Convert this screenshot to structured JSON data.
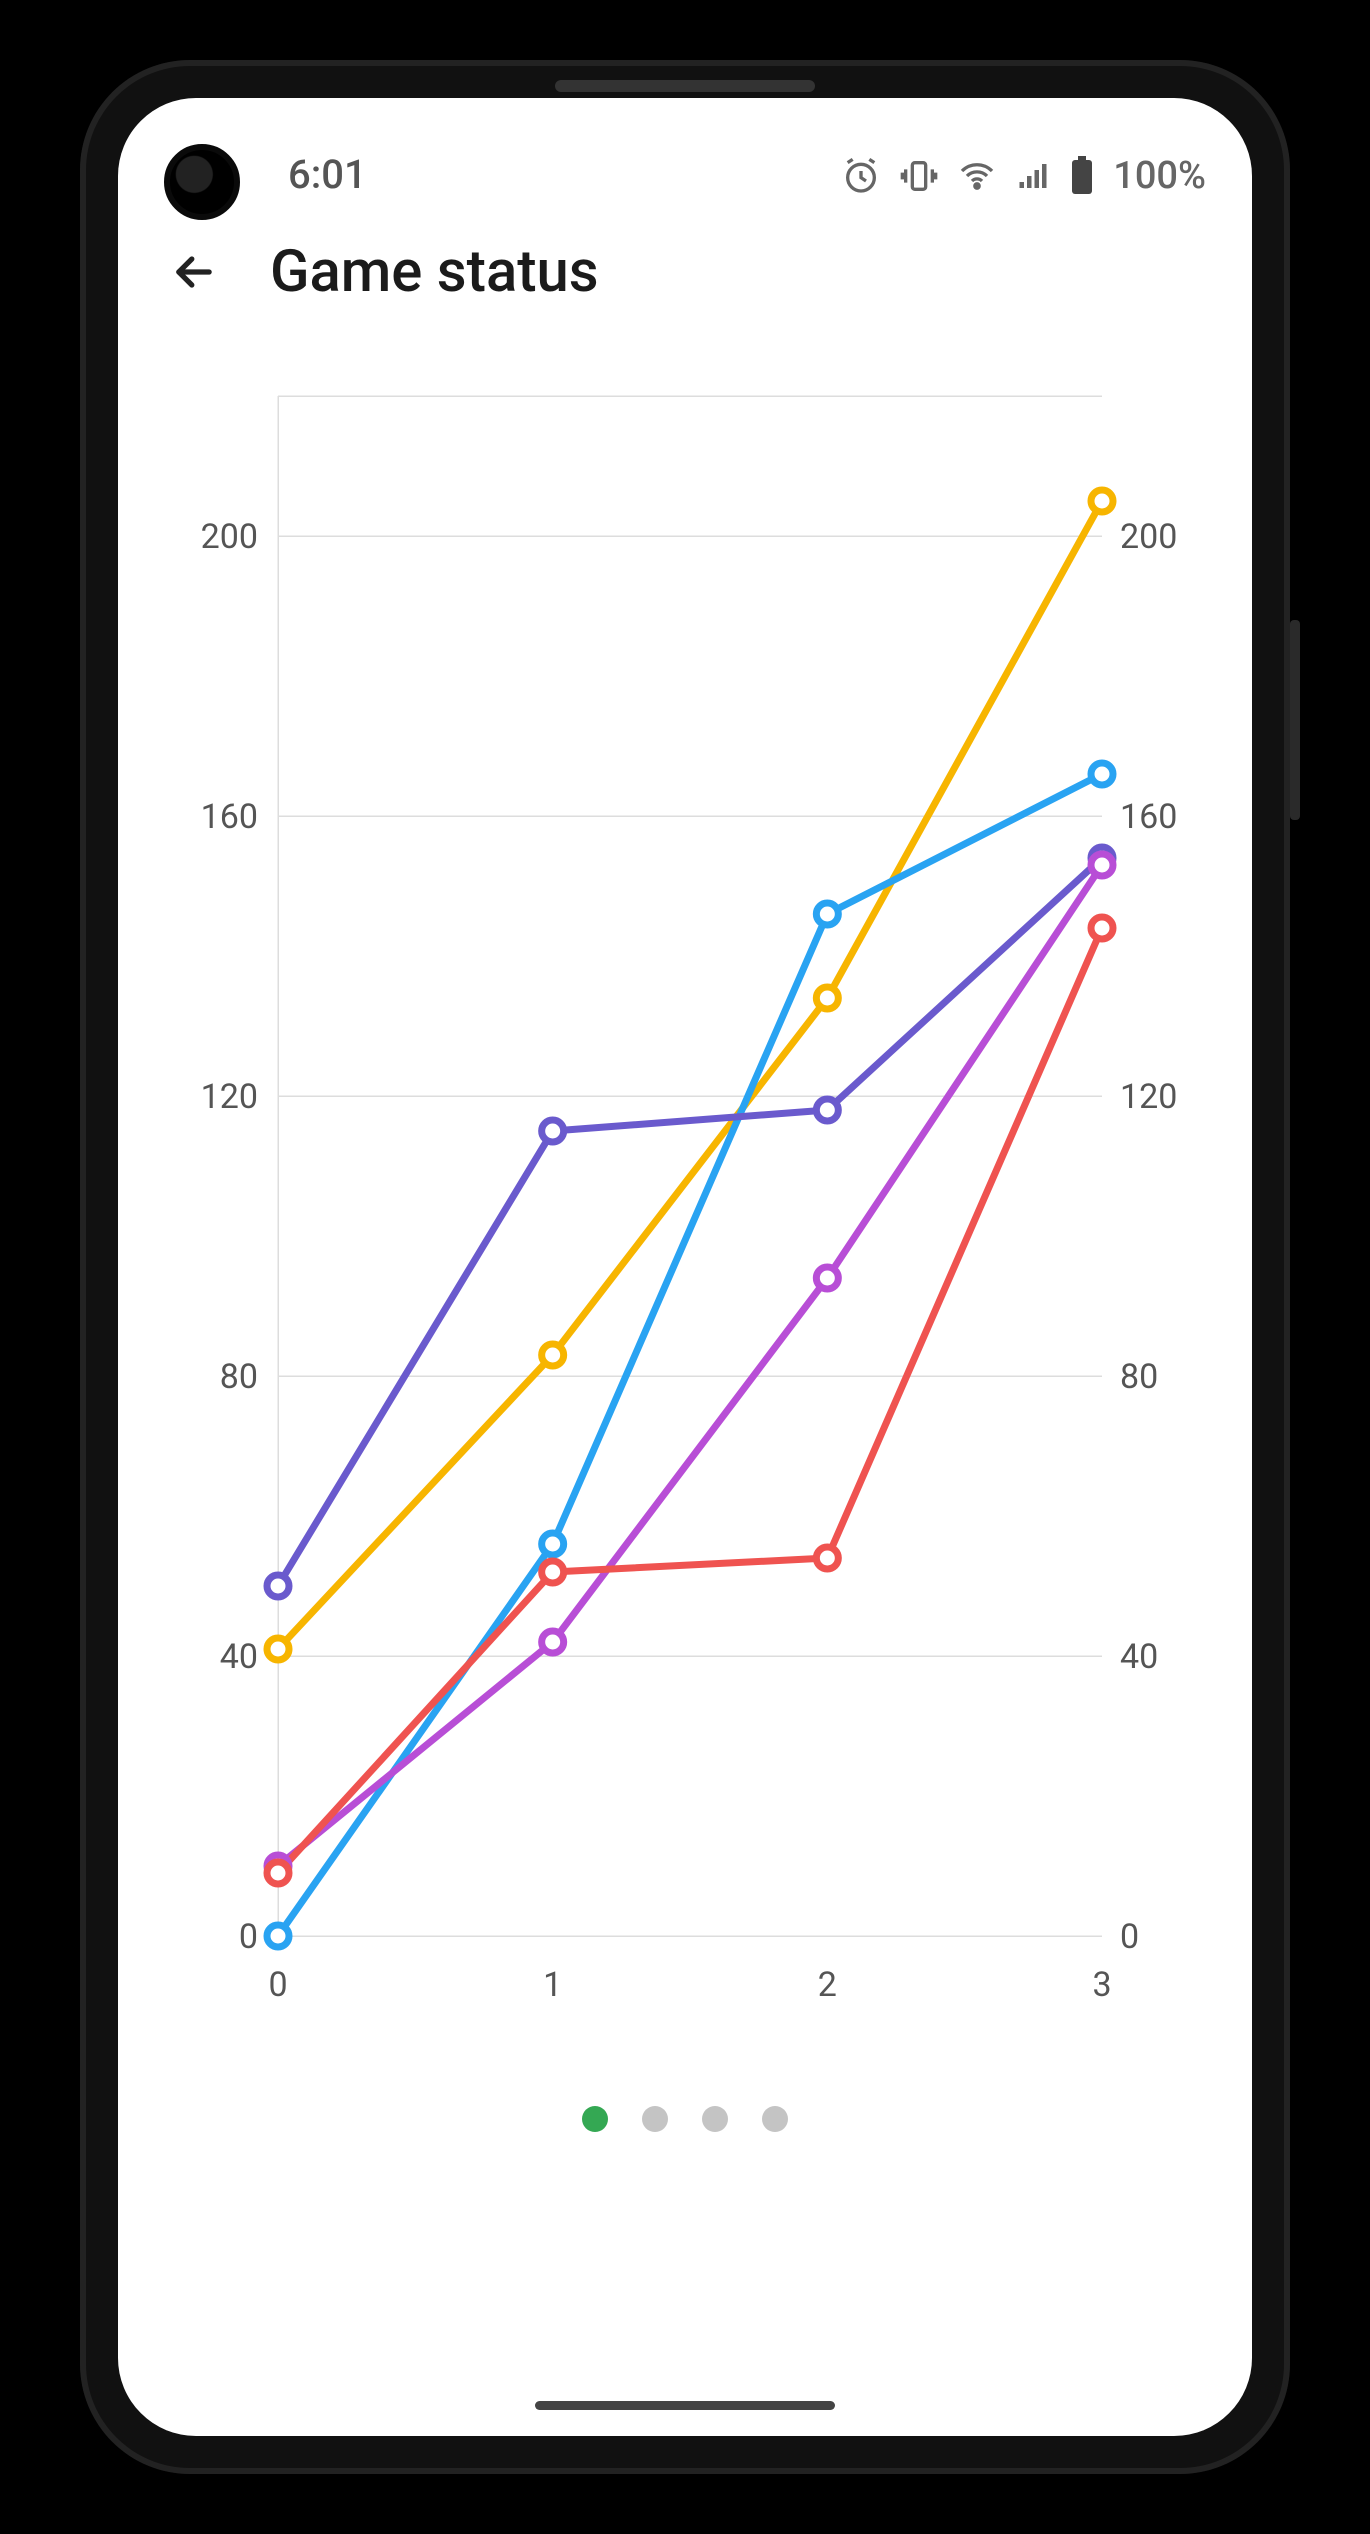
{
  "statusbar": {
    "time": "6:01",
    "battery_text": "100%",
    "icons": [
      "alarm",
      "vibrate",
      "wifi",
      "signal",
      "battery"
    ]
  },
  "appbar": {
    "title": "Game status"
  },
  "pager": {
    "count": 4,
    "active": 0
  },
  "chart_data": {
    "type": "line",
    "title": "",
    "xlabel": "",
    "ylabel": "",
    "x": [
      0,
      1,
      2,
      3
    ],
    "ylim": [
      0,
      220
    ],
    "y_ticks_left": [
      0,
      40,
      80,
      120,
      160,
      200
    ],
    "y_ticks_right": [
      0,
      40,
      80,
      120,
      160,
      200
    ],
    "series": [
      {
        "name": "orange",
        "color": "#f7b500",
        "values": [
          41,
          83,
          134,
          205
        ]
      },
      {
        "name": "blue",
        "color": "#29a3f2",
        "values": [
          0,
          56,
          146,
          166
        ]
      },
      {
        "name": "indigo",
        "color": "#6a5acd",
        "values": [
          50,
          115,
          118,
          154
        ]
      },
      {
        "name": "purple",
        "color": "#b84ed6",
        "values": [
          10,
          42,
          94,
          153
        ]
      },
      {
        "name": "red",
        "color": "#ef5350",
        "values": [
          9,
          52,
          54,
          144
        ]
      }
    ]
  }
}
